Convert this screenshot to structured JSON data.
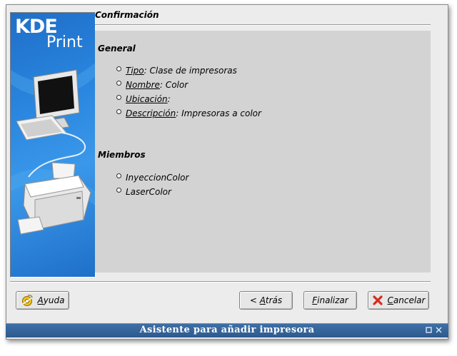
{
  "window": {
    "title": "Asistente para añadir impresora"
  },
  "banner": {
    "brand": "KDE",
    "sub": "Print"
  },
  "page": {
    "title": "Confirmación"
  },
  "general": {
    "heading": "General",
    "items": [
      {
        "key": "Tipo",
        "value": ": Clase de impresoras"
      },
      {
        "key": "Nombre",
        "value": ": Color"
      },
      {
        "key": "Ubicación",
        "value": ":"
      },
      {
        "key": "Descripción",
        "value": ": Impresoras a color"
      }
    ]
  },
  "members": {
    "heading": "Miembros",
    "items": [
      "InyeccionColor",
      "LaserColor"
    ]
  },
  "buttons": {
    "help": {
      "mnemonic": "A",
      "rest": "yuda"
    },
    "back": {
      "prefix": "< ",
      "mnemonic": "A",
      "rest": "trás"
    },
    "finish": {
      "mnemonic": "F",
      "rest": "inalizar"
    },
    "cancel": {
      "mnemonic": "C",
      "rest": "ancelar"
    }
  },
  "icons": {
    "help": "help-lifebuoy-icon",
    "cancel": "cancel-x-icon",
    "window_restore": "restore-icon",
    "window_close": "close-icon"
  },
  "colors": {
    "banner_blue": "#2a86df",
    "titlebar": "#3f6fa6",
    "panel": "#d3d3d3",
    "cancel_red": "#d62b20"
  }
}
